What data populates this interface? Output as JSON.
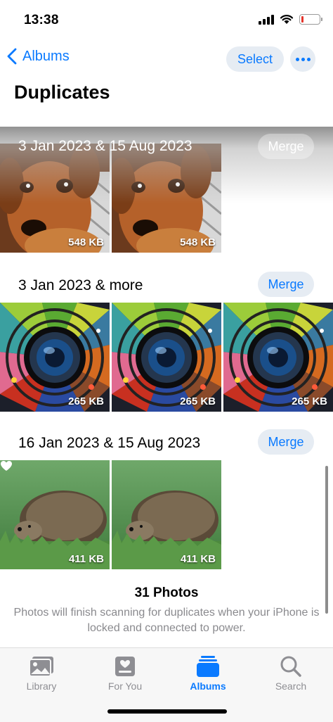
{
  "status_bar": {
    "time": "13:38"
  },
  "nav": {
    "back_label": "Albums",
    "select_label": "Select",
    "title": "Duplicates"
  },
  "groups": [
    {
      "date": "3 Jan 2023 & 15 Aug 2023",
      "merge_label": "Merge",
      "photos": [
        {
          "size": "548 KB",
          "subject": "dog"
        },
        {
          "size": "548 KB",
          "subject": "dog"
        }
      ]
    },
    {
      "date": "3 Jan 2023 & more",
      "merge_label": "Merge",
      "photos": [
        {
          "size": "265 KB",
          "subject": "camera-lens"
        },
        {
          "size": "265 KB",
          "subject": "camera-lens"
        },
        {
          "size": "265 KB",
          "subject": "camera-lens"
        }
      ]
    },
    {
      "date": "16 Jan 2023 & 15 Aug 2023",
      "merge_label": "Merge",
      "photos": [
        {
          "size": "411 KB",
          "subject": "hedgehog",
          "favorite": true
        },
        {
          "size": "411 KB",
          "subject": "hedgehog"
        }
      ]
    }
  ],
  "footer": {
    "count": "31 Photos",
    "info": "Photos will finish scanning for duplicates when your iPhone is locked and connected to power."
  },
  "tabs": [
    {
      "label": "Library",
      "icon": "library-icon",
      "active": false
    },
    {
      "label": "For You",
      "icon": "for-you-icon",
      "active": false
    },
    {
      "label": "Albums",
      "icon": "albums-icon",
      "active": true
    },
    {
      "label": "Search",
      "icon": "search-icon",
      "active": false
    }
  ],
  "colors": {
    "accent": "#0a7aff",
    "inactive": "#8e8e93",
    "button_bg": "#e6ecf3"
  }
}
